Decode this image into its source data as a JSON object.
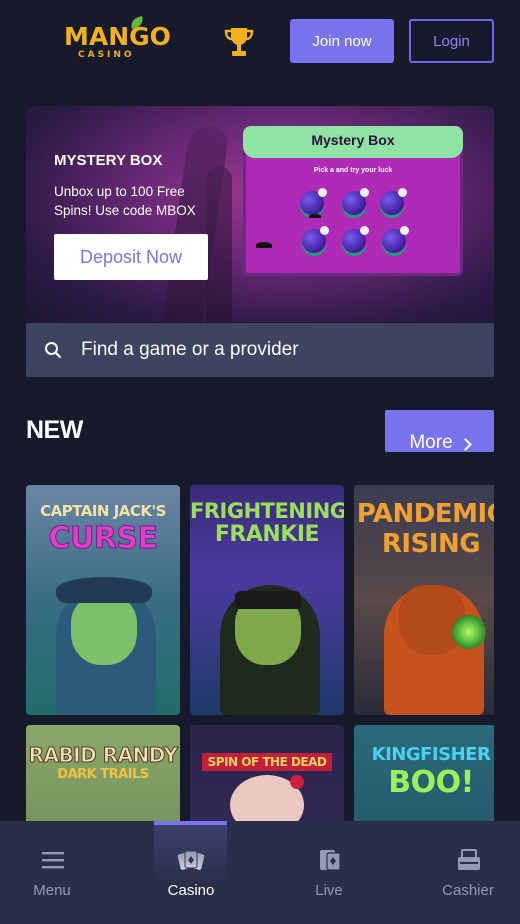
{
  "header": {
    "logo_text": "MANGO",
    "logo_sub": "CASINO",
    "join_label": "Join now",
    "login_label": "Login"
  },
  "banner": {
    "title": "MYSTERY BOX",
    "description": "Unbox up to 100 Free Spins! Use code MBOX",
    "cta_label": "Deposit Now",
    "art_title": "Mystery Box",
    "art_subtitle": "Pick a  and try your luck"
  },
  "search": {
    "placeholder": "Find a game or a provider"
  },
  "new_section": {
    "title": "NEW",
    "more_label": "More"
  },
  "games": [
    {
      "title_line1": "CAPTAIN JACK'S",
      "title_line2": "CURSE"
    },
    {
      "title_line1": "FRIGHTENING",
      "title_line2": "FRANKIE"
    },
    {
      "title_line1": "PANDEMIC",
      "title_line2": "RISING"
    },
    {
      "title_line1": "RABID RANDY",
      "title_line2": "DARK TRAILS"
    },
    {
      "title_line1": "SPIN OF THE DEAD",
      "title_line2": ""
    },
    {
      "title_line1": "KINGFISHER",
      "title_line2": "BOO!"
    }
  ],
  "bottom_nav": {
    "items": [
      {
        "label": "Menu",
        "icon": "menu-icon"
      },
      {
        "label": "Casino",
        "icon": "casino-cards-icon"
      },
      {
        "label": "Live",
        "icon": "live-cards-icon"
      },
      {
        "label": "Cashier",
        "icon": "cashier-icon"
      }
    ],
    "active": "Casino"
  },
  "colors": {
    "background": "#161a2b",
    "accent": "#7a73f0",
    "logo": "#f3b21b",
    "search_bg": "#3c4461",
    "nav_bg": "#2a2f49"
  }
}
